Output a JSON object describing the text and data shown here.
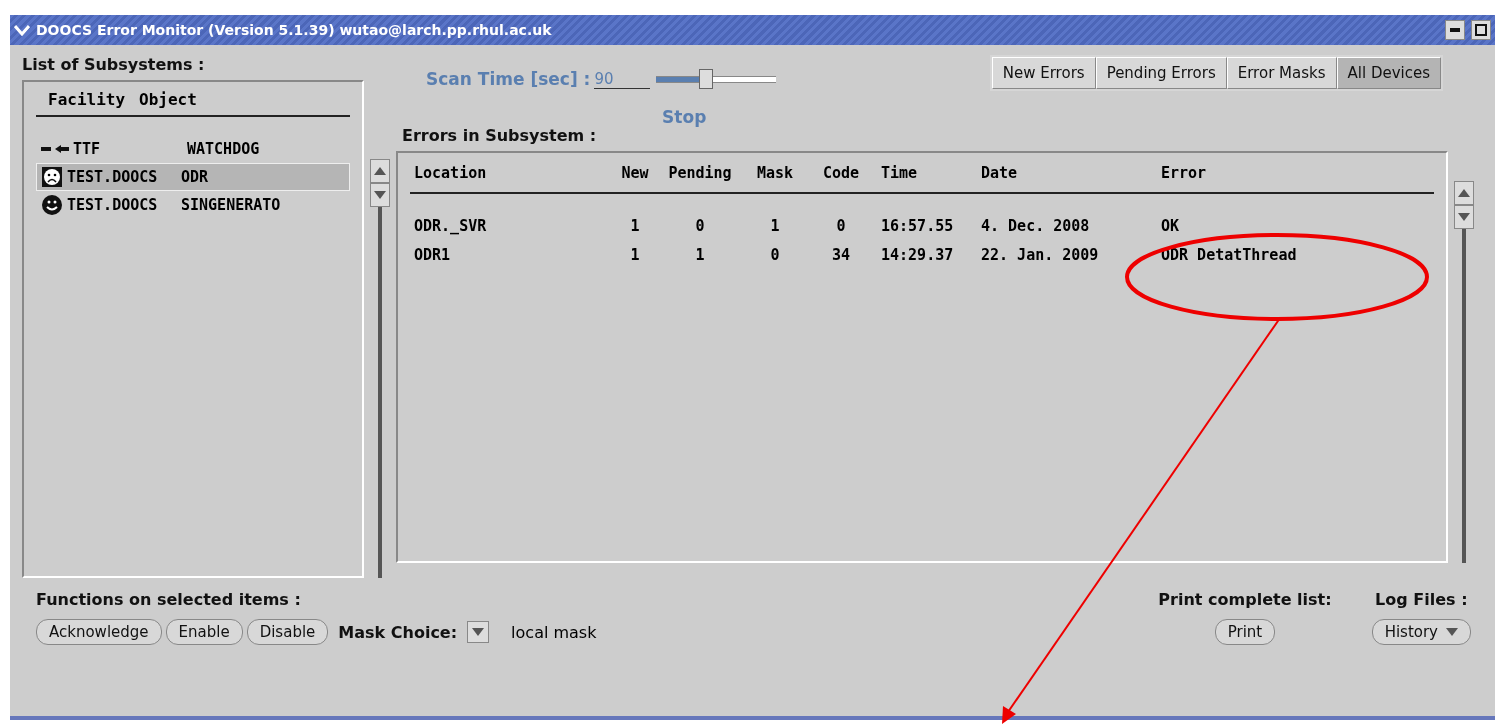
{
  "window": {
    "title": "DOOCS Error Monitor  (Version 5.1.39)   wutao@larch.pp.rhul.ac.uk"
  },
  "subsystems": {
    "title": "List of Subsystems :",
    "columns": [
      "Facility",
      "Object"
    ],
    "items": [
      {
        "kind": "arrow",
        "facility": "TTF",
        "object": "WATCHDOG",
        "selected": false
      },
      {
        "kind": "sad",
        "facility": "TEST.DOOCS",
        "object": "ODR",
        "selected": true
      },
      {
        "kind": "happy",
        "facility": "TEST.DOOCS",
        "object": "SINGENERATO",
        "selected": false
      }
    ]
  },
  "scan": {
    "label": "Scan Time [sec] :",
    "value": "90",
    "level": 0.4,
    "stop": "Stop"
  },
  "tabs": [
    {
      "label": "New Errors",
      "selected": false
    },
    {
      "label": "Pending Errors",
      "selected": false
    },
    {
      "label": "Error Masks",
      "selected": false
    },
    {
      "label": "All Devices",
      "selected": true
    }
  ],
  "errors": {
    "title": "Errors in Subsystem :",
    "columns": [
      "Location",
      "New",
      "Pending",
      "Mask",
      "Code",
      "Time",
      "Date",
      "Error"
    ],
    "rows": [
      [
        "ODR._SVR",
        "1",
        "0",
        "1",
        "0",
        "16:57.55",
        "4. Dec. 2008",
        "OK"
      ],
      [
        "ODR1",
        "1",
        "1",
        "0",
        "34",
        "14:29.37",
        "22. Jan. 2009",
        "ODR DetatThread"
      ]
    ]
  },
  "functions": {
    "title": "Functions on selected items :",
    "buttons": [
      "Acknowledge",
      "Enable",
      "Disable"
    ],
    "mask_label": "Mask Choice:",
    "mask_value": "local mask"
  },
  "print": {
    "title": "Print complete list:",
    "button": "Print"
  },
  "logs": {
    "title": "Log Files :",
    "button": "History"
  }
}
